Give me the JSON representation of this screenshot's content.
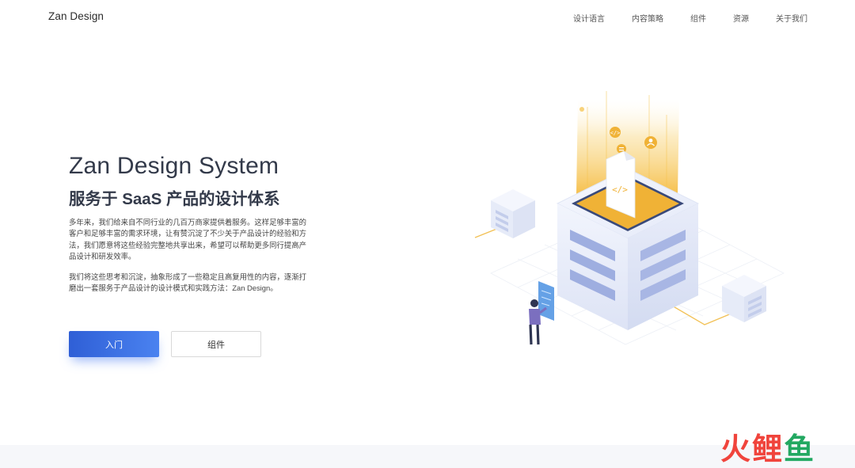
{
  "brand": "Zan Design",
  "nav": [
    {
      "label": "设计语言"
    },
    {
      "label": "内容策略"
    },
    {
      "label": "组件"
    },
    {
      "label": "资源"
    },
    {
      "label": "关于我们"
    }
  ],
  "hero": {
    "title": "Zan Design System",
    "subtitle": "服务于 SaaS 产品的设计体系",
    "paragraph1": "多年来，我们给来自不同行业的几百万商家提供着服务。这样足够丰富的客户和足够丰富的需求环境，让有赞沉淀了不少关于产品设计的经验和方法，我们愿意将这些经验完整地共享出来，希望可以帮助更多同行提高产品设计和研发效率。",
    "paragraph2": "我们将这些思考和沉淀，抽象形成了一些稳定且高复用性的内容，逐渐打磨出一套服务于产品设计的设计模式和实践方法：Zan Design。",
    "primary_button": "入门",
    "secondary_button": "组件"
  },
  "watermark": {
    "chars": [
      "火",
      "鲤",
      "鱼"
    ],
    "colors": [
      "#f0443c",
      "#f0443c",
      "#22a861"
    ]
  },
  "colors": {
    "primary": "#3a6ee8",
    "accent_gold": "#f5b93a",
    "cube": "#e9edfb",
    "stripe": "#9eaee0"
  }
}
